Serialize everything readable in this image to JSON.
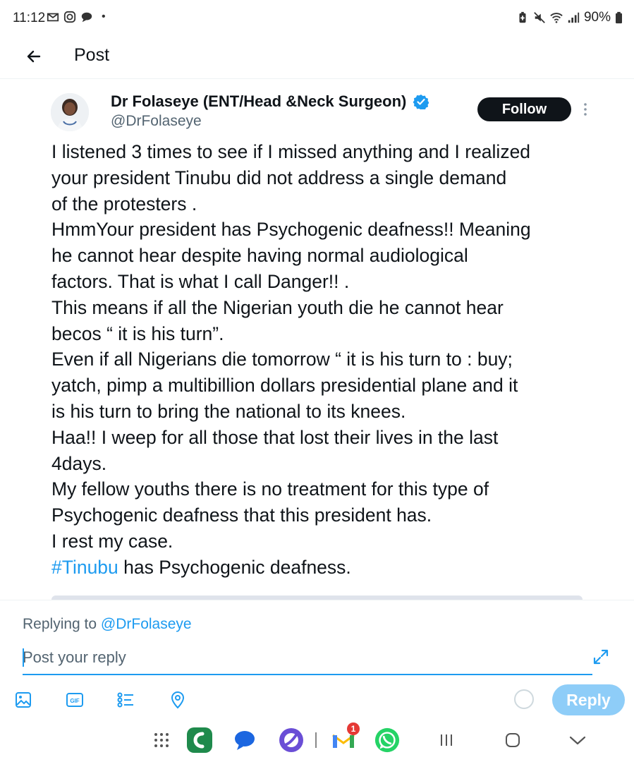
{
  "status_bar": {
    "time": "11:12",
    "dot": "•",
    "battery": "90%",
    "left_icons": [
      "gmail-icon",
      "instagram-icon",
      "chat-bubbles-icon"
    ],
    "right_icons": [
      "battery-saver-icon",
      "mute-icon",
      "wifi-icon",
      "signal-icon",
      "battery-icon"
    ]
  },
  "header": {
    "title": "Post",
    "back_icon": "arrow-left-icon"
  },
  "post": {
    "author_name": "Dr Folaseye (ENT/Head &Neck Surgeon)",
    "author_handle": "@DrFolaseye",
    "follow_label": "Follow",
    "lines": [
      "I listened 3 times to see if I missed anything and I realized",
      "your president Tinubu did not address a single demand",
      "of the protesters .",
      "HmmYour president has Psychogenic deafness!! Meaning",
      "he cannot hear despite having normal audiological",
      "factors. That is what I call Danger!! .",
      "This means if all the Nigerian youth die he cannot hear",
      "becos “ it is his turn”.",
      "Even if all Nigerians die tomorrow “ it is his turn to : buy;",
      "yatch, pimp a multibillion dollars presidential plane and it",
      "is his turn to bring the national to its knees.",
      "Haa!! I weep for all those that lost their lives in the last",
      "4days.",
      "My fellow youths there is no treatment for this type of",
      "Psychogenic deafness that this president has.",
      "I rest my case."
    ],
    "hashtag": "#Tinubu",
    "last_line_rest": " has Psychogenic deafness."
  },
  "composer": {
    "replying_prefix": "Replying to ",
    "replying_handle": "@DrFolaseye",
    "placeholder": "Post your reply",
    "value": "",
    "reply_label": "Reply",
    "toolbar_icons": [
      "image-icon",
      "gif-icon",
      "poll-icon",
      "location-icon"
    ]
  },
  "nav_dock": {
    "apps": [
      "app-drawer-icon",
      "green-phone-app-icon",
      "messages-app-icon",
      "browser-app-icon",
      "gmail-app-icon",
      "whatsapp-app-icon"
    ],
    "gmail_badge": "1",
    "system_buttons": [
      "recents-button",
      "home-button",
      "back-button"
    ]
  },
  "colors": {
    "accent": "#1d9bf0",
    "reply_button_disabled": "#8ecdf8",
    "text_primary": "#0f1419",
    "text_secondary": "#536471",
    "follow_bg": "#0f1419"
  }
}
